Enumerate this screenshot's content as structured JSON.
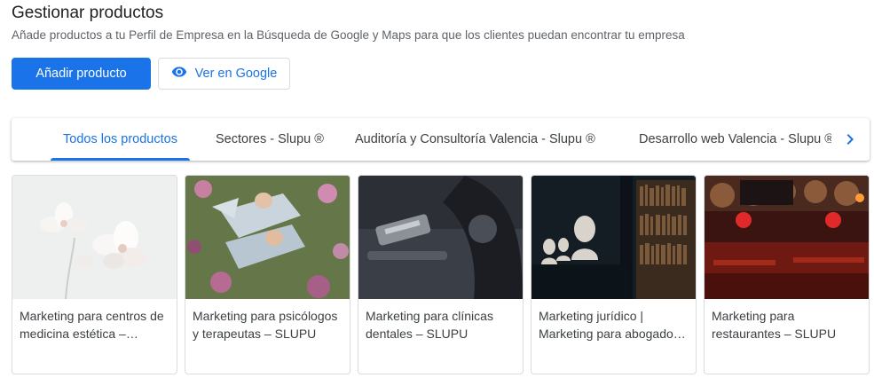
{
  "header": {
    "title": "Gestionar productos",
    "subtitle": "Añade productos a tu Perfil de Empresa en la Búsqueda de Google y Maps para que los clientes puedan encontrar tu empresa"
  },
  "actions": {
    "add_product": "Añadir producto",
    "view_on_google": "Ver en Google",
    "view_icon": "eye-icon"
  },
  "tabs": [
    {
      "label": "Todos los productos",
      "active": true
    },
    {
      "label": "Sectores - Slupu ®",
      "active": false
    },
    {
      "label": "Auditoría y Consultoría Valencia - Slupu ®",
      "active": false
    },
    {
      "label": "Desarrollo web Valencia - Slupu ®",
      "active": false
    }
  ],
  "tabs_next_icon": "chevron-right-icon",
  "products": [
    {
      "name": "Marketing para centros de medicina estética – SLUPU"
    },
    {
      "name": "Marketing para psicólogos y terapeutas – SLUPU"
    },
    {
      "name": "Marketing para clínicas dentales – SLUPU"
    },
    {
      "name": "Marketing jurídico | Marketing para abogados – SLUPU"
    },
    {
      "name": "Marketing para restaurantes – SLUPU"
    }
  ],
  "colors": {
    "accent": "#1a73e8",
    "text": "#202124",
    "muted": "#5f6368",
    "border": "#dadce0"
  }
}
